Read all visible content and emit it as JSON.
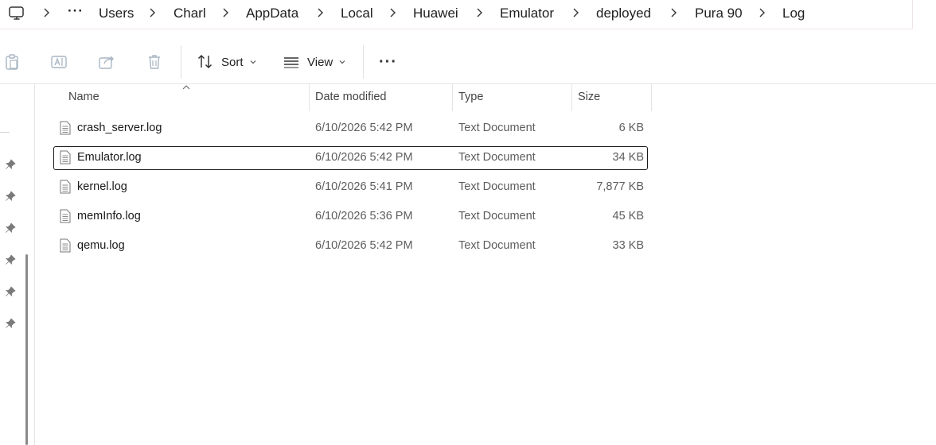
{
  "breadcrumb": {
    "overflow": "···",
    "items": [
      "Users",
      "Charl",
      "AppData",
      "Local",
      "Huawei",
      "Emulator",
      "deployed",
      "Pura 90",
      "Log"
    ]
  },
  "toolbar": {
    "sort_label": "Sort",
    "view_label": "View",
    "more_label": "···"
  },
  "columns": {
    "name": "Name",
    "date_modified": "Date modified",
    "type": "Type",
    "size": "Size"
  },
  "files": [
    {
      "name": "crash_server.log",
      "date": "6/10/2026 5:42 PM",
      "type": "Text Document",
      "size": "6 KB"
    },
    {
      "name": "Emulator.log",
      "date": "6/10/2026 5:42 PM",
      "type": "Text Document",
      "size": "34 KB"
    },
    {
      "name": "kernel.log",
      "date": "6/10/2026 5:41 PM",
      "type": "Text Document",
      "size": "7,877 KB"
    },
    {
      "name": "memInfo.log",
      "date": "6/10/2026 5:36 PM",
      "type": "Text Document",
      "size": "45 KB"
    },
    {
      "name": "qemu.log",
      "date": "6/10/2026 5:42 PM",
      "type": "Text Document",
      "size": "33 KB"
    }
  ],
  "selected_file": "Emulator.log",
  "colors": {
    "disabled_icon": "#a9b6c4",
    "selection_border": "#1a1a1a",
    "secondary_text": "#5d5d5d"
  }
}
